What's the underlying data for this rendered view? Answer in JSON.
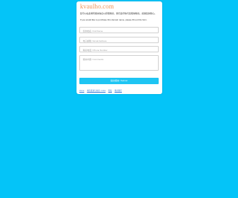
{
  "colors": {
    "background": "#04C4F8",
    "brand": "#F0955A",
    "submit_bg": "#1EC5F3",
    "card": "#ffffff"
  },
  "header": {
    "logo_text": "kvaulho.com"
  },
  "intro": {
    "zh": "您可以在此填写留言信息以获取联系，我们会尽快与您取得联系。感谢您的耐心。",
    "en": "If you would like to purchase this domain name, please fill out this form."
  },
  "form": {
    "name_placeholder": "您的姓名 / Full Name",
    "email_placeholder": "电子邮箱 / Email Address",
    "phone_placeholder": "联系电话 / Phone Number",
    "message_placeholder": "留言内容 / Comments",
    "submit_label": "提交留言 / Submit"
  },
  "footer": {
    "item1": "Home",
    "item2": "域名投资与交易 / Links",
    "item3": "隐私",
    "item4": "联系我们"
  }
}
